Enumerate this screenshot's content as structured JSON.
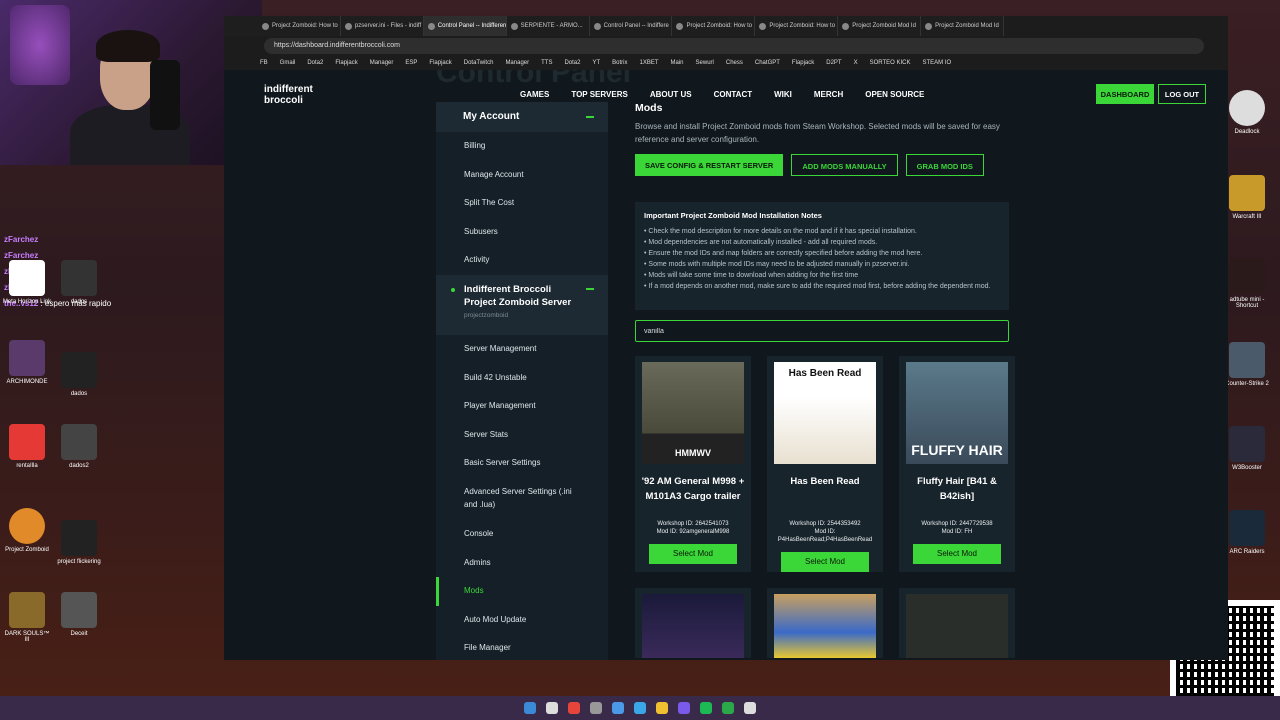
{
  "browser": {
    "tabs": [
      {
        "label": "Project Zomboid: How to",
        "active": false
      },
      {
        "label": "pzserver.ini - Files - indiff",
        "active": false
      },
      {
        "label": "Control Panel -- Indifferen",
        "active": true
      },
      {
        "label": "SERPIENTE - ARMO...",
        "active": false
      },
      {
        "label": "Control Panel -- Indiffere",
        "active": false
      },
      {
        "label": "Project Zomboid: How to",
        "active": false
      },
      {
        "label": "Project Zomboid: How to",
        "active": false
      },
      {
        "label": "Project Zomboid Mod Id",
        "active": false
      },
      {
        "label": "Project Zomboid Mod Id",
        "active": false
      }
    ],
    "url": "https://dashboard.indifferentbroccoli.com",
    "bookmarks": [
      "FB",
      "Gmail",
      "Dota2",
      "Flapjack",
      "Manager",
      "ESP",
      "Flapjack",
      "DotaTwitch",
      "Manager",
      "TTS",
      "Dota2",
      "YT",
      "Botrix",
      "1XBET",
      "Main",
      "Sewurl",
      "Chess",
      "ChatGPT",
      "Flapjack",
      "D2PT",
      "X",
      "SORTEO KICK",
      "STEAM IO"
    ]
  },
  "site": {
    "logo": "indifferent broccoli",
    "ghost_title": "Control Panel",
    "nav": [
      "GAMES",
      "TOP SERVERS",
      "ABOUT US",
      "CONTACT",
      "WIKI",
      "MERCH",
      "OPEN SOURCE"
    ],
    "dashboard_label": "DASHBOARD",
    "logout_label": "LOG OUT"
  },
  "sidebar": {
    "account_title": "My Account",
    "account_items": [
      "Billing",
      "Manage Account",
      "Split The Cost",
      "Subusers",
      "Activity"
    ],
    "server_title": "Indifferent Broccoli Project Zomboid Server",
    "server_sub": "projectzomboid",
    "server_items": [
      "Server Management",
      "Build 42 Unstable",
      "Player Management",
      "Server Stats",
      "Basic Server Settings",
      "Advanced Server Settings (.ini and .lua)",
      "Console",
      "Admins",
      "Mods",
      "Auto Mod Update",
      "File Manager"
    ],
    "active_item": "Mods"
  },
  "main": {
    "title": "Mods",
    "description": "Browse and install Project Zomboid mods from Steam Workshop. Selected mods will be saved for easy reference and server configuration.",
    "buttons": {
      "save": "SAVE CONFIG & RESTART SERVER",
      "add": "ADD MODS MANUALLY",
      "grab": "GRAB MOD IDS"
    },
    "notes_title": "Important Project Zomboid Mod Installation Notes",
    "notes": [
      "• Check the mod description for more details on the mod and if it has special installation.",
      "• Mod dependencies are not automatically installed - add all required mods.",
      "• Ensure the mod IDs and map folders are correctly specified before adding the mod here.",
      "• Some mods with multiple mod IDs may need to be adjusted manually in pzserver.ini.",
      "• Mods will take some time to download when adding for the first time",
      "• If a mod depends on another mod, make sure to add the required mod first, before adding the dependent mod."
    ],
    "search_value": "vanilla",
    "cards": [
      {
        "title": "'92 AM General M998 + M101A3 Cargo trailer",
        "workshop": "Workshop ID: 2642541073",
        "modid": "Mod ID: 92amgeneralM998",
        "thumb_text": "HMMWV",
        "select": "Select Mod"
      },
      {
        "title": "Has Been Read",
        "workshop": "Workshop ID: 2544353492",
        "modid": "Mod ID: P4HasBeenRead;P4HasBeenRead",
        "thumb_text": "Has Been Read",
        "select": "Select Mod"
      },
      {
        "title": "Fluffy Hair [B41 & B42ish]",
        "workshop": "Workshop ID: 2447729538",
        "modid": "Mod ID: FH",
        "thumb_text": "FLUFFY HAIR",
        "select": "Select Mod"
      }
    ]
  },
  "desktop": {
    "chat": [
      {
        "name": "zFarchez",
        "msg": ""
      },
      {
        "name": "zFarchez",
        "msg": ""
      },
      {
        "name": "zFarchez",
        "msg": ""
      },
      {
        "name": "zFarchez",
        "msg": ""
      },
      {
        "name": "the..vs12",
        "msg": "espero más rapido"
      }
    ],
    "left_icons": [
      "Meta Horizon Link",
      "dados",
      "ARCHIMONDE",
      "dados",
      "rentaIlla",
      "dados2",
      "Project Zomboid",
      "project flickering",
      "DARK SOULS™ III",
      "Deceit"
    ],
    "right_icons": [
      "Deadlock",
      "Warcraft III",
      "adtube mini - Shortcut",
      "Counter-Strike 2",
      "W3Booster",
      "ARC Raiders"
    ]
  },
  "colors": {
    "accent": "#3bd638",
    "bg": "#10181e",
    "panel": "#18242c"
  }
}
